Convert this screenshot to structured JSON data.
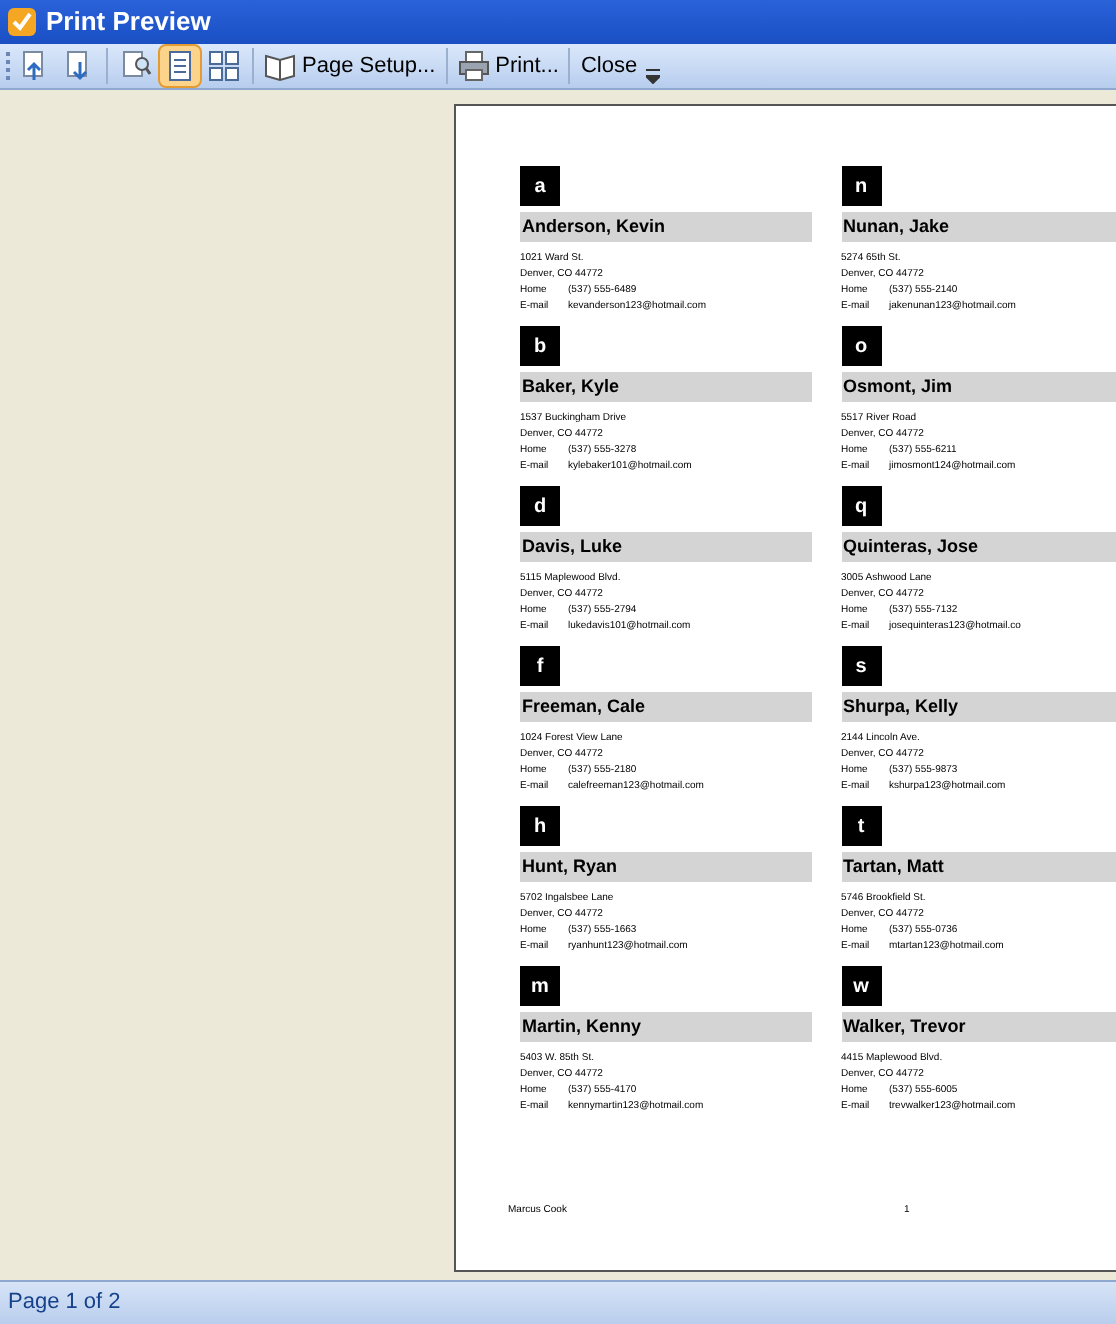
{
  "window": {
    "title": "Print Preview"
  },
  "toolbar": {
    "view_buttons": [
      {
        "selected": true
      },
      {
        "selected": false
      }
    ],
    "page_setup": "Page Setup...",
    "print": "Print...",
    "close": "Close"
  },
  "page": {
    "columns": [
      [
        {
          "letter": "a",
          "name": "Anderson, Kevin",
          "address": "1021 Ward St.",
          "city": "Denver, CO 44772",
          "phone_label": "Home",
          "phone": "(537) 555-6489",
          "email_label": "E-mail",
          "email": "kevanderson123@hotmail.com"
        },
        {
          "letter": "b",
          "name": "Baker, Kyle",
          "address": "1537 Buckingham Drive",
          "city": "Denver, CO 44772",
          "phone_label": "Home",
          "phone": "(537) 555-3278",
          "email_label": "E-mail",
          "email": "kylebaker101@hotmail.com"
        },
        {
          "letter": "d",
          "name": "Davis, Luke",
          "address": "5115 Maplewood Blvd.",
          "city": "Denver, CO 44772",
          "phone_label": "Home",
          "phone": "(537) 555-2794",
          "email_label": "E-mail",
          "email": "lukedavis101@hotmail.com"
        },
        {
          "letter": "f",
          "name": "Freeman, Cale",
          "address": "1024 Forest View Lane",
          "city": "Denver, CO 44772",
          "phone_label": "Home",
          "phone": "(537) 555-2180",
          "email_label": "E-mail",
          "email": "calefreeman123@hotmail.com"
        },
        {
          "letter": "h",
          "name": "Hunt, Ryan",
          "address": "5702 Ingalsbee Lane",
          "city": "Denver, CO 44772",
          "phone_label": "Home",
          "phone": "(537) 555-1663",
          "email_label": "E-mail",
          "email": "ryanhunt123@hotmail.com"
        },
        {
          "letter": "m",
          "name": "Martin, Kenny",
          "address": "5403 W. 85th St.",
          "city": "Denver, CO 44772",
          "phone_label": "Home",
          "phone": "(537) 555-4170",
          "email_label": "E-mail",
          "email": "kennymartin123@hotmail.com"
        }
      ],
      [
        {
          "letter": "n",
          "name": "Nunan, Jake",
          "address": "5274 65th St.",
          "city": "Denver, CO 44772",
          "phone_label": "Home",
          "phone": "(537) 555-2140",
          "email_label": "E-mail",
          "email": "jakenunan123@hotmail.com"
        },
        {
          "letter": "o",
          "name": "Osmont, Jim",
          "address": "5517 River Road",
          "city": "Denver, CO 44772",
          "phone_label": "Home",
          "phone": "(537) 555-6211",
          "email_label": "E-mail",
          "email": "jimosmont124@hotmail.com"
        },
        {
          "letter": "q",
          "name": "Quinteras, Jose",
          "address": "3005 Ashwood Lane",
          "city": "Denver, CO 44772",
          "phone_label": "Home",
          "phone": "(537) 555-7132",
          "email_label": "E-mail",
          "email": "josequinteras123@hotmail.co"
        },
        {
          "letter": "s",
          "name": "Shurpa, Kelly",
          "address": "2144 Lincoln Ave.",
          "city": "Denver, CO 44772",
          "phone_label": "Home",
          "phone": "(537) 555-9873",
          "email_label": "E-mail",
          "email": "kshurpa123@hotmail.com"
        },
        {
          "letter": "t",
          "name": "Tartan, Matt",
          "address": "5746 Brookfield St.",
          "city": "Denver, CO 44772",
          "phone_label": "Home",
          "phone": "(537) 555-0736",
          "email_label": "E-mail",
          "email": "mtartan123@hotmail.com"
        },
        {
          "letter": "w",
          "name": "Walker, Trevor",
          "address": "4415 Maplewood Blvd.",
          "city": "Denver, CO 44772",
          "phone_label": "Home",
          "phone": "(537) 555-6005",
          "email_label": "E-mail",
          "email": "trevwalker123@hotmail.com"
        }
      ]
    ],
    "footer_name": "Marcus Cook",
    "page_number": "1"
  },
  "status_bar": {
    "text": "Page 1 of 2"
  }
}
